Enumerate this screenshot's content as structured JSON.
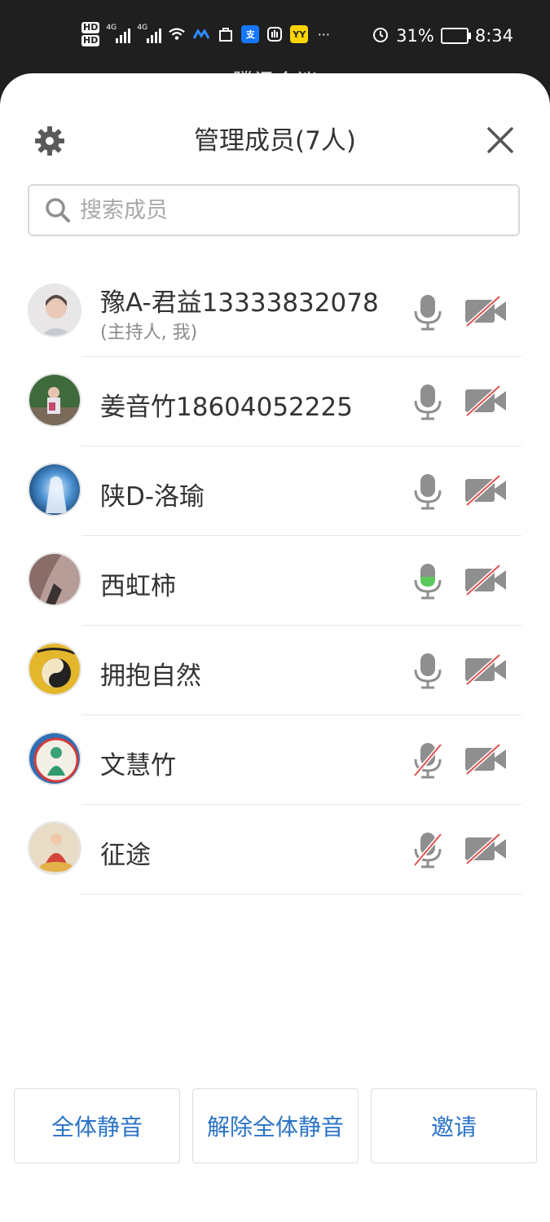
{
  "status_bar": {
    "hd1": "HD",
    "hd2": "HD",
    "net1": "4G",
    "net2": "4G",
    "more": "···",
    "battery_pct": "31%",
    "time": "8:34",
    "app_badge_yy": "YY",
    "app_badge_zhi": "支"
  },
  "background_title": "腾讯会议",
  "panel": {
    "title": "管理成员(7人)",
    "search_placeholder": "搜索成员"
  },
  "members": [
    {
      "name": "豫A-君益13333832078",
      "sub": "(主持人, 我)",
      "mic": "off-gray",
      "camera": "off"
    },
    {
      "name": "姜音竹18604052225",
      "sub": "",
      "mic": "off-gray",
      "camera": "off"
    },
    {
      "name": "陕D-洛瑜",
      "sub": "",
      "mic": "off-gray",
      "camera": "off"
    },
    {
      "name": "西虹柿",
      "sub": "",
      "mic": "speaking",
      "camera": "off"
    },
    {
      "name": "拥抱自然",
      "sub": "",
      "mic": "off-gray",
      "camera": "off"
    },
    {
      "name": "文慧竹",
      "sub": "",
      "mic": "muted",
      "camera": "off"
    },
    {
      "name": "征途",
      "sub": "",
      "mic": "muted",
      "camera": "off"
    }
  ],
  "actions": {
    "mute_all": "全体静音",
    "unmute_all": "解除全体静音",
    "invite": "邀请"
  },
  "colors": {
    "accent": "#2a73c6",
    "speaking": "#5ac85a",
    "muted_slash": "#e0524f",
    "icon_gray": "#8f8f8f"
  }
}
